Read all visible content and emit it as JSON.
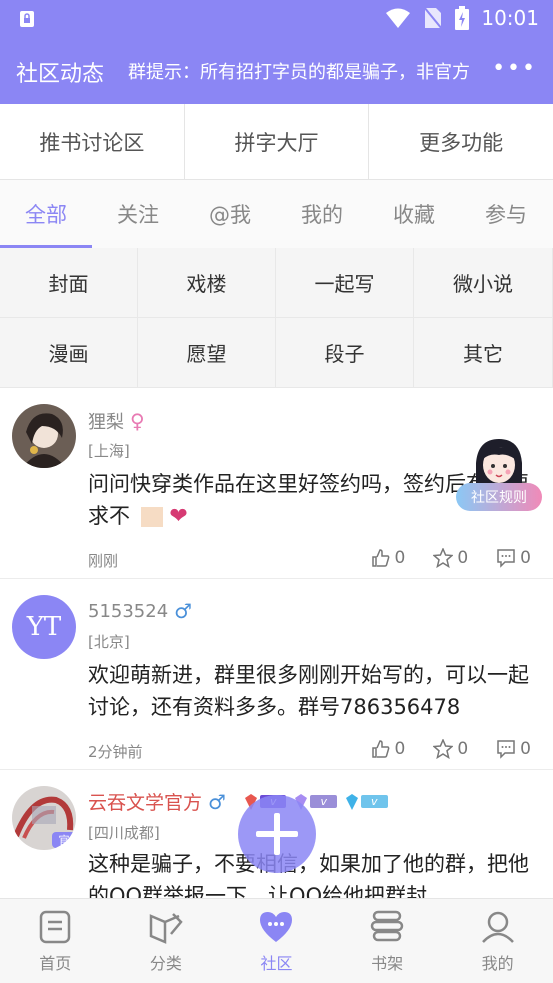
{
  "status_bar": {
    "time": "10:01"
  },
  "app_bar": {
    "title": "社区动态",
    "marquee": "群提示：所有招打字员的都是骗子，非官方",
    "more": "•••"
  },
  "top_tabs": [
    "推书讨论区",
    "拼字大厅",
    "更多功能"
  ],
  "filter_tabs": [
    "全部",
    "关注",
    "@我",
    "我的",
    "收藏",
    "参与"
  ],
  "categories": [
    "封面",
    "戏楼",
    "一起写",
    "微小说",
    "漫画",
    "愿望",
    "段子",
    "其它"
  ],
  "rules_badge": "社区规则",
  "posts": [
    {
      "username": "狸梨",
      "gender": "♀",
      "location": "[上海]",
      "text": "问问快穿类作品在这里好签约吗，签约后有啥要求不",
      "time": "刚刚",
      "likes": "0",
      "stars": "0",
      "comments": "0"
    },
    {
      "username": "5153524",
      "gender": "♂",
      "avatar_text": "YT",
      "location": "[北京]",
      "text": "欢迎萌新进，群里很多刚刚开始写的，可以一起讨论，还有资料多多。群号786356478",
      "time": "2分钟前",
      "likes": "0",
      "stars": "0",
      "comments": "0"
    },
    {
      "username": "云吞文学官方",
      "gender": "♂",
      "avatar_badge": "官",
      "location": "[四川成都]",
      "text": "这种是骗子，不要相信，如果加了他的群，把他的QQ群举报一下，让QQ给他把群封",
      "vip_badges": [
        "v",
        "v",
        "v"
      ]
    }
  ],
  "bottom_nav": [
    "首页",
    "分类",
    "社区",
    "书架",
    "我的"
  ],
  "colors": {
    "accent": "#8b86f4",
    "female": "#e87ab3",
    "male": "#4a90d9",
    "official": "#d9534f"
  }
}
